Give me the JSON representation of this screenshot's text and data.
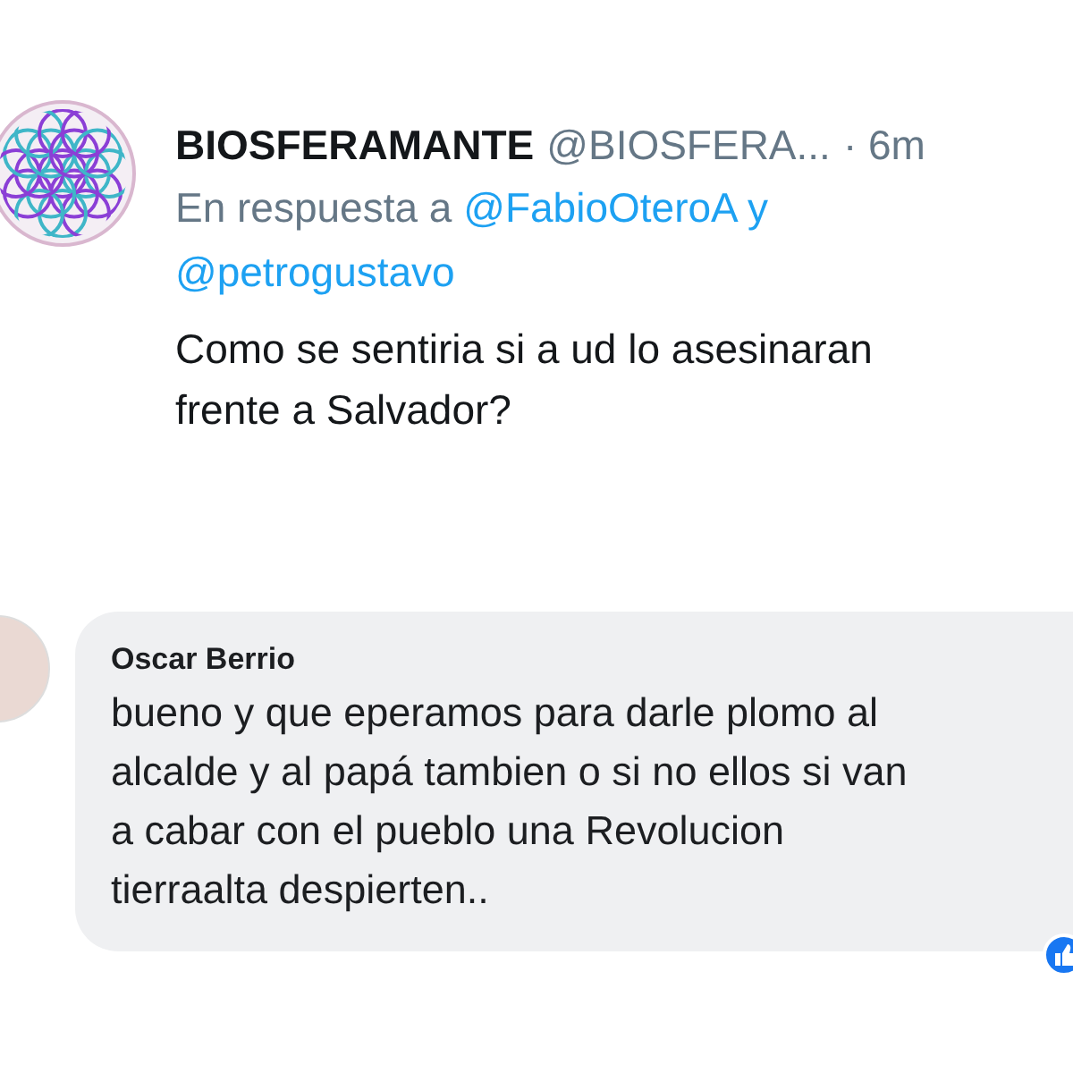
{
  "tweet": {
    "display_name": "BIOSFERAMANTE",
    "handle": "@BIOSFERA...",
    "time": "· 6m",
    "reply_prefix": "En respuesta a",
    "mentions": [
      "@FabioOteroA",
      "@petrogustavo"
    ],
    "mention_joiner": "y",
    "text_lines": [
      "Como se sentiria si a ud lo asesinaran",
      "frente a Salvador?"
    ]
  },
  "comment": {
    "author": "Oscar Berrio",
    "text_lines": [
      "bueno y que eperamos para darle plomo al",
      "alcalde y al papá tambien o si no ellos si van",
      "a cabar con el pueblo una Revolucion",
      "tierraalta despierten.."
    ]
  }
}
